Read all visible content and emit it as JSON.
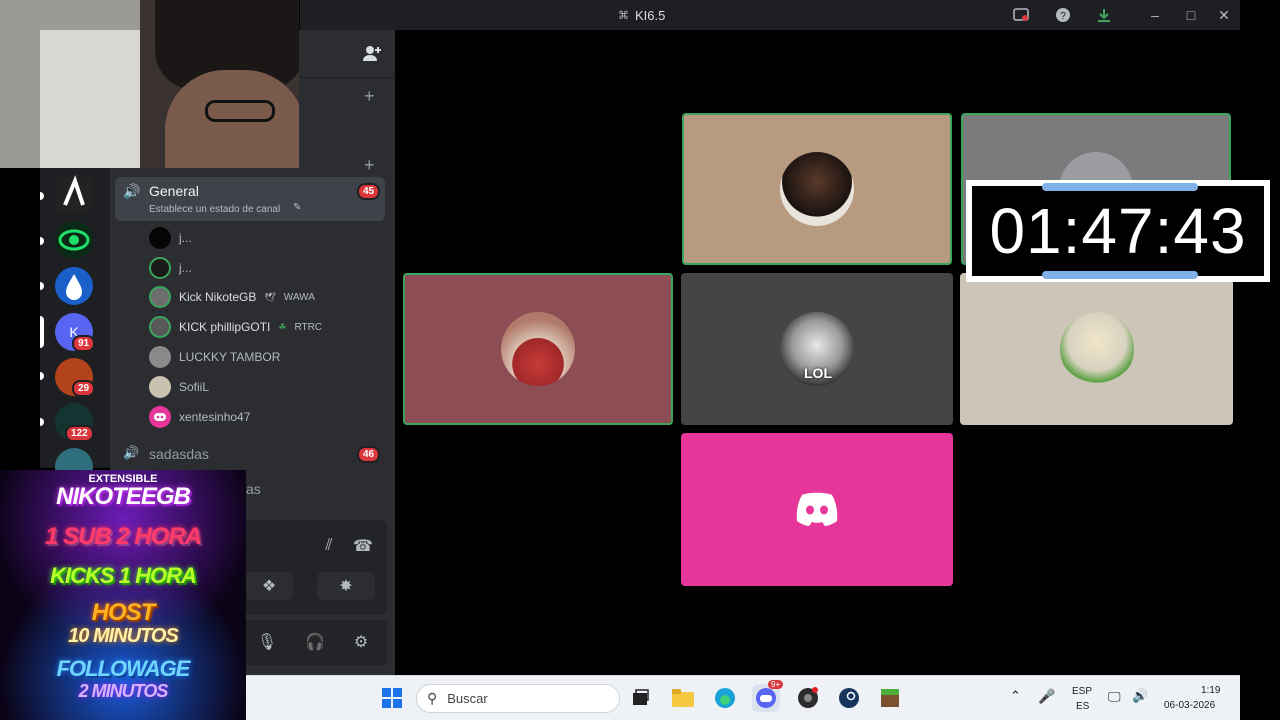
{
  "window": {
    "title": "KI6.5",
    "title_icon": "discord-hash-icon"
  },
  "titlebar_icons": [
    "screen-share-icon",
    "help-icon",
    "download-icon",
    "minimize-icon",
    "maximize-icon",
    "close-icon"
  ],
  "sidebar": {
    "add_friend_icon": "person-add-icon",
    "add_icon": "+",
    "servers": [
      {
        "name": "server-1",
        "badge": ""
      },
      {
        "name": "server-2",
        "badge": ""
      },
      {
        "name": "server-3",
        "badge": ""
      },
      {
        "name": "server-4",
        "badge": "91"
      },
      {
        "name": "server-5",
        "badge": "29"
      },
      {
        "name": "server-6",
        "badge": "122"
      },
      {
        "name": "server-7",
        "badge": ""
      }
    ]
  },
  "channels": {
    "general": {
      "name": "General",
      "status": "Establece un estado de canal",
      "count": "45"
    },
    "members": [
      {
        "name": "j...",
        "tag": ""
      },
      {
        "name": "j...",
        "tag": ""
      },
      {
        "name": "Kick NikoteGB",
        "tag": "WAWA"
      },
      {
        "name": "KICK phillipGOTI",
        "tag": "RTRC"
      },
      {
        "name": "LUCKKY TAMBOR",
        "tag": ""
      },
      {
        "name": "SofiiL",
        "tag": ""
      },
      {
        "name": "xentesinho47",
        "tag": ""
      }
    ],
    "sadasdas": {
      "name": "sadasdas",
      "count": "46"
    },
    "partial": "as"
  },
  "promo": {
    "line1": "EXTENSIBLE",
    "line2": "NIKOTEEGB",
    "line3": "1 SUB 2 HORA",
    "line4": "KICKS 1 HORA",
    "line5": "HOST",
    "line6": "10 MINUTOS",
    "line7": "FOLLOWAGE",
    "line8": "2 MINUTOS"
  },
  "video": {
    "tile_lol_label": "LOL",
    "timer": "01:47:43"
  },
  "taskbar": {
    "search_placeholder": "Buscar",
    "lang1": "ESP",
    "lang2": "ES",
    "time": "1:19",
    "date": "06-03-2026",
    "discord_badge": "9+"
  },
  "colors": {
    "discord_blurple": "#5865f2",
    "speaking_green": "#3ba55c",
    "mention_red": "#da373c",
    "discord_tile": "#e6369a"
  }
}
